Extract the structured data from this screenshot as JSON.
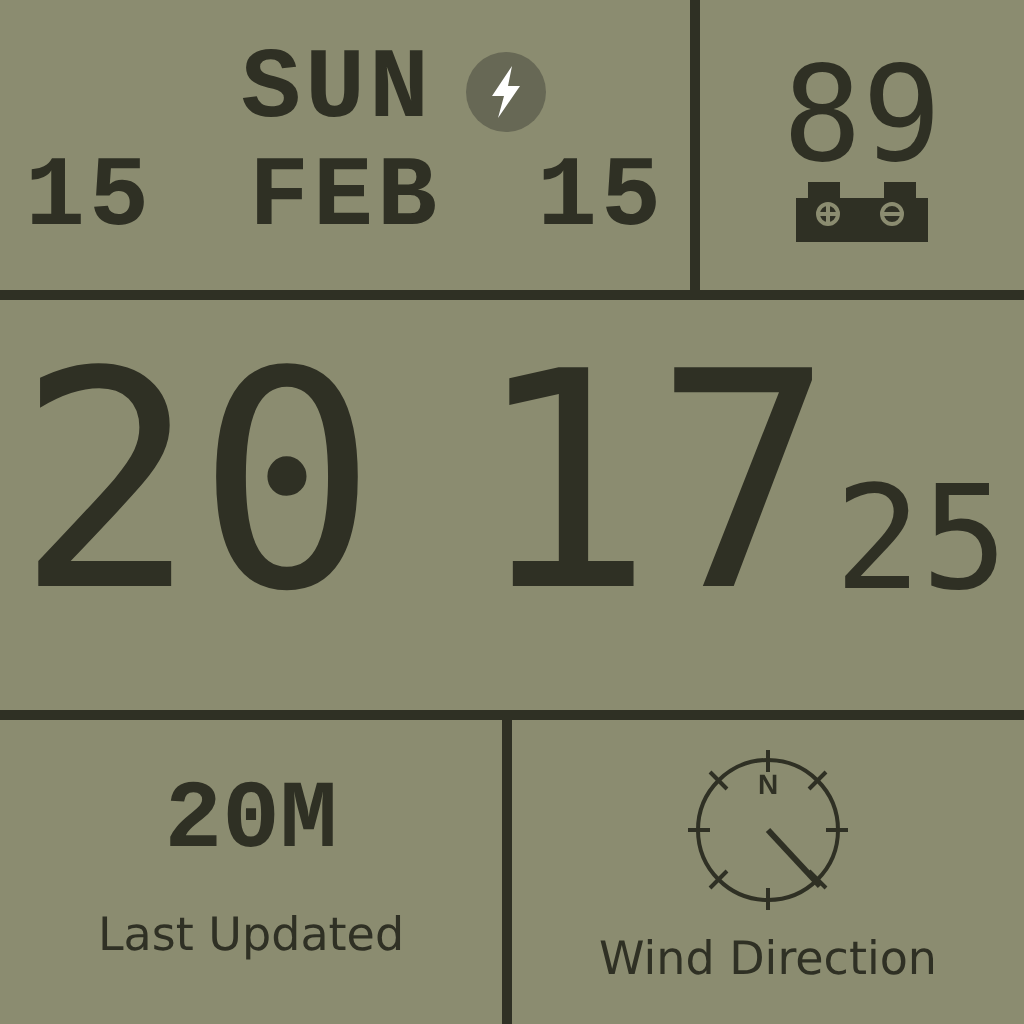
{
  "date": {
    "weekday": "SUN",
    "charging": true,
    "day": "15",
    "month": "FEB",
    "year": "15"
  },
  "battery": {
    "percent": "89"
  },
  "time": {
    "hours": "20",
    "minutes": "17",
    "seconds": "25"
  },
  "last_updated": {
    "value": "20M",
    "label": "Last Updated"
  },
  "wind": {
    "compass_mark": "N",
    "label": "Wind Direction"
  }
}
